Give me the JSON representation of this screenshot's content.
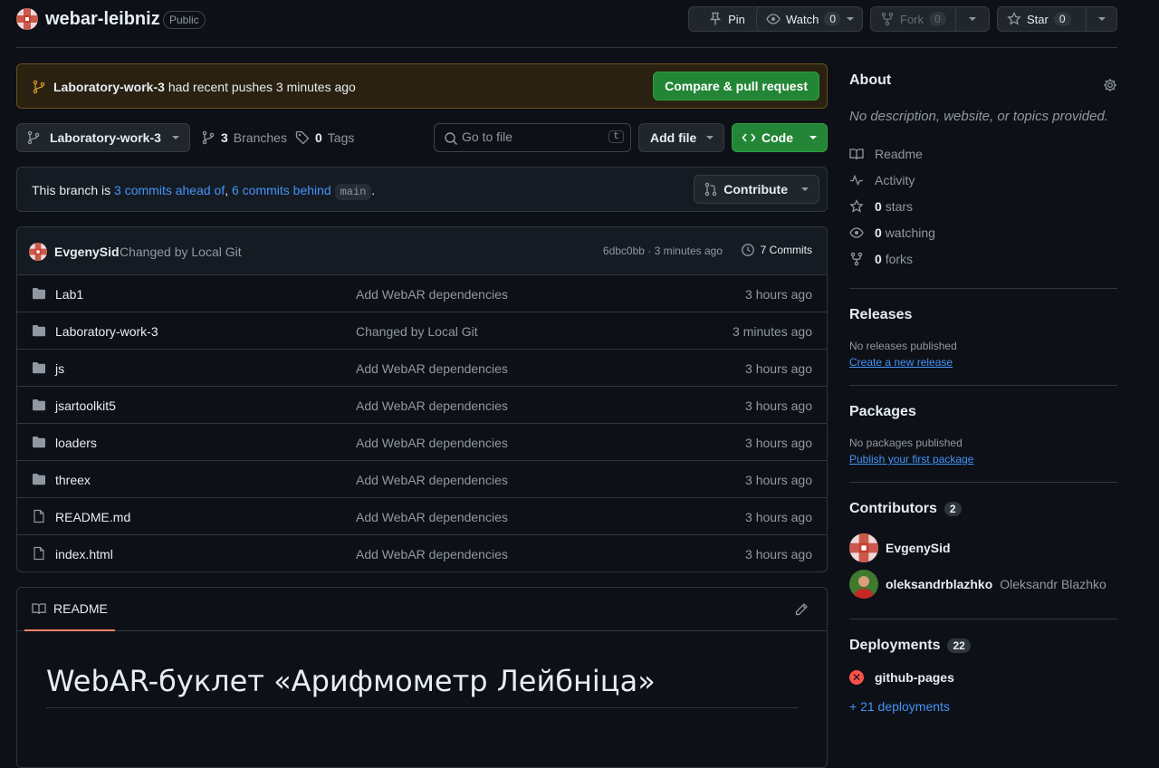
{
  "repo": {
    "name": "webar-leibniz",
    "visibility": "Public",
    "pin_label": "Pin",
    "watch_label": "Watch",
    "watch_count": "0",
    "fork_label": "Fork",
    "fork_count": "0",
    "star_label": "Star",
    "star_count": "0"
  },
  "flash": {
    "branch": "Laboratory-work-3",
    "text": "had recent pushes 3 minutes ago",
    "button": "Compare & pull request"
  },
  "toolbar": {
    "branch": "Laboratory-work-3",
    "branches_count": "3",
    "branches_label": "Branches",
    "tags_count": "0",
    "tags_label": "Tags",
    "goto_placeholder": "Go to file",
    "goto_kbd": "t",
    "add_file": "Add file",
    "code": "Code"
  },
  "branch_info": {
    "prefix": "This branch is",
    "ahead": "3 commits ahead of",
    "sep": ",",
    "behind": "6 commits behind",
    "base": "main",
    "suffix": ".",
    "contribute": "Contribute"
  },
  "latest_commit": {
    "author": "EvgenySid",
    "message": "Changed by Local Git",
    "meta": "6dbc0bb · 3 minutes ago",
    "commits_label": "7 Commits"
  },
  "files": [
    {
      "type": "dir",
      "name": "Lab1",
      "message": "Add WebAR dependencies",
      "time": "3 hours ago"
    },
    {
      "type": "dir",
      "name": "Laboratory-work-3",
      "message": "Changed by Local Git",
      "time": "3 minutes ago"
    },
    {
      "type": "dir",
      "name": "js",
      "message": "Add WebAR dependencies",
      "time": "3 hours ago"
    },
    {
      "type": "dir",
      "name": "jsartoolkit5",
      "message": "Add WebAR dependencies",
      "time": "3 hours ago"
    },
    {
      "type": "dir",
      "name": "loaders",
      "message": "Add WebAR dependencies",
      "time": "3 hours ago"
    },
    {
      "type": "dir",
      "name": "threex",
      "message": "Add WebAR dependencies",
      "time": "3 hours ago"
    },
    {
      "type": "file",
      "name": "README.md",
      "message": "Add WebAR dependencies",
      "time": "3 hours ago"
    },
    {
      "type": "file",
      "name": "index.html",
      "message": "Add WebAR dependencies",
      "time": "3 hours ago"
    }
  ],
  "readme": {
    "tab": "README",
    "title": "WebAR-буклет «Арифмометр Лейбніца»"
  },
  "sidebar": {
    "about_title": "About",
    "about_desc": "No description, website, or topics provided.",
    "items": [
      {
        "icon": "book-icon",
        "bold": "",
        "label": "Readme"
      },
      {
        "icon": "pulse-icon",
        "bold": "",
        "label": "Activity"
      },
      {
        "icon": "star-icon",
        "bold": "0",
        "label": "stars"
      },
      {
        "icon": "eye-icon",
        "bold": "0",
        "label": "watching"
      },
      {
        "icon": "fork-icon",
        "bold": "0",
        "label": "forks"
      }
    ],
    "releases_title": "Releases",
    "releases_text": "No releases published",
    "releases_link": "Create a new release",
    "packages_title": "Packages",
    "packages_text": "No packages published",
    "packages_link": "Publish your first package",
    "contributors_title": "Contributors",
    "contributors_count": "2",
    "contributors": [
      {
        "login": "EvgenySid",
        "name": ""
      },
      {
        "login": "oleksandrblazhko",
        "name": "Oleksandr Blazhko"
      }
    ],
    "deployments_title": "Deployments",
    "deployments_count": "22",
    "deployment_name": "github-pages",
    "deployments_more": "+ 21 deployments"
  },
  "colors": {
    "bg": "#0d1117",
    "accent_green": "#238636",
    "link": "#4493f8",
    "flash_bg": "#2b2111",
    "error": "#f85149"
  }
}
